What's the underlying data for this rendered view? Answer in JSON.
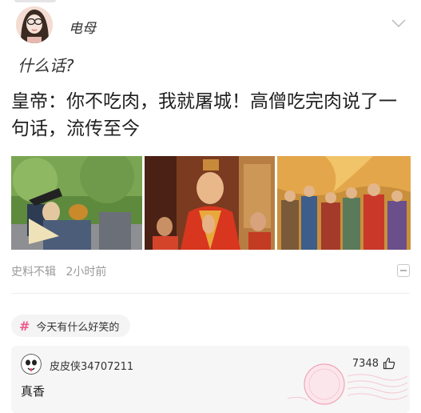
{
  "post": {
    "author": "电母",
    "user_comment": "什么话?",
    "headline": "皇帝：你不吃肉，我就屠城！高僧吃完肉说了一句话，流传至今",
    "source": "史料不辑",
    "time": "2小时前"
  },
  "topic": {
    "label": "今天有什么好笑的"
  },
  "comment": {
    "username": "皮皮侠34707211",
    "likes": "7348",
    "text": "真香",
    "stamp_text": "神评"
  },
  "colors": {
    "accent": "#f0588a",
    "meta_text": "#9a9a9a",
    "comment_bg": "#f6f6f6",
    "stamp": "#f2a3b5"
  }
}
